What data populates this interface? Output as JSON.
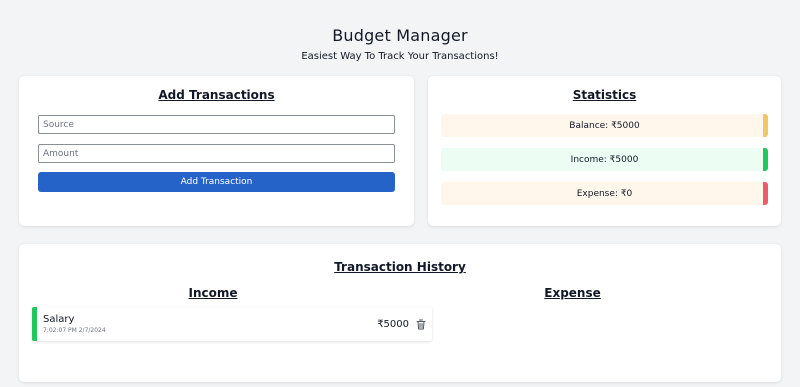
{
  "header": {
    "title": "Budget Manager",
    "subtitle": "Easiest Way To Track Your Transactions!"
  },
  "add_card": {
    "title": "Add Transactions",
    "source_placeholder": "Source",
    "source_value": "",
    "amount_placeholder": "Amount",
    "amount_value": "",
    "button_label": "Add Transaction"
  },
  "stats_card": {
    "title": "Statistics",
    "items": [
      {
        "label": "Balance: ₹5000",
        "bar_color": "#f4c66a"
      },
      {
        "label": "Income: ₹5000",
        "bar_color": "#22c55e"
      },
      {
        "label": "Expense: ₹0",
        "bar_color": "#ef5b6b"
      }
    ]
  },
  "history": {
    "title": "Transaction History",
    "income_title": "Income",
    "expense_title": "Expense",
    "income": [
      {
        "name": "Salary",
        "timestamp": "7:02:07 PM 2/7/2024",
        "amount": "₹5000",
        "icon": "trash-icon"
      }
    ],
    "expense": []
  },
  "colors": {
    "accent": "#2563c9",
    "income": "#22c55e",
    "balance": "#f4c66a",
    "expense": "#ef5b6b"
  }
}
